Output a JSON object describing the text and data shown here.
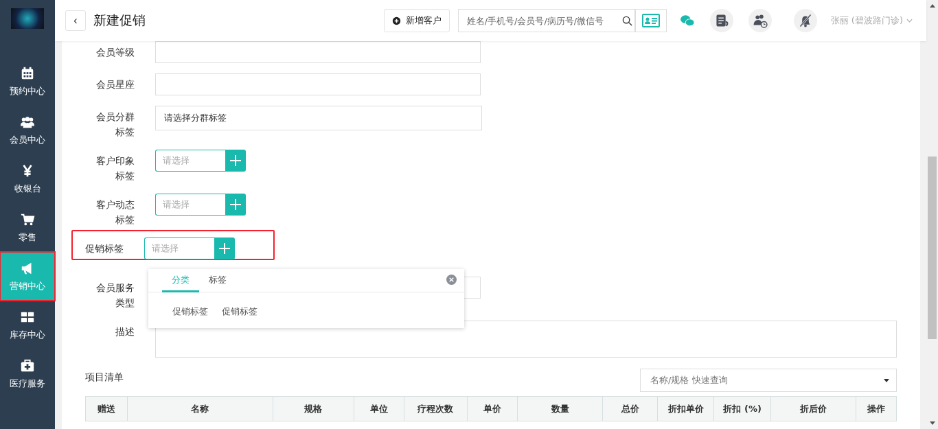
{
  "sidebar": {
    "items": [
      {
        "label": "预约中心",
        "selected": false,
        "highlighted": false
      },
      {
        "label": "会员中心",
        "selected": false,
        "highlighted": false
      },
      {
        "label": "收银台",
        "selected": false,
        "highlighted": false
      },
      {
        "label": "零售",
        "selected": false,
        "highlighted": false
      },
      {
        "label": "营销中心",
        "selected": true,
        "highlighted": true
      },
      {
        "label": "库存中心",
        "selected": false,
        "highlighted": false
      },
      {
        "label": "医疗服务",
        "selected": false,
        "highlighted": false
      }
    ]
  },
  "header": {
    "back": "‹",
    "title": "新建促销",
    "add_customer_button": "新增客户",
    "search": {
      "placeholder": "姓名/手机号/会员号/病历号/微信号"
    },
    "user": "张丽 (碧波路门诊)"
  },
  "form": {
    "rows": [
      {
        "kind": "text",
        "label": "会员等级",
        "highlighted": false
      },
      {
        "kind": "text",
        "label": "会员星座",
        "highlighted": false
      },
      {
        "kind": "text",
        "label": "会员分群标签",
        "value": "请选择分群标签",
        "highlighted": false
      },
      {
        "kind": "select-add",
        "label": "客户印象标签",
        "placeholder": "请选择",
        "highlighted": false
      },
      {
        "kind": "select-add",
        "label": "客户动态标签",
        "placeholder": "请选择",
        "highlighted": false
      },
      {
        "kind": "select-add",
        "label": "促销标签",
        "placeholder": "请选择",
        "highlighted": true,
        "popup": {
          "tabs": [
            {
              "label": "分类",
              "selected": true
            },
            {
              "label": "标签",
              "selected": false
            }
          ],
          "items": [
            "促销标签",
            "促销标签"
          ]
        }
      },
      {
        "kind": "text",
        "label": "会员服务类型",
        "highlighted": false
      },
      {
        "kind": "textarea",
        "label": "描述",
        "highlighted": false
      }
    ]
  },
  "items_section": {
    "title": "项目清单",
    "quick_search": {
      "placeholder": "名称/规格 快速查询"
    },
    "table": {
      "columns": [
        "赠送",
        "名称",
        "规格",
        "单位",
        "疗程次数",
        "单价",
        "数量",
        "总价",
        "折扣单价",
        "折扣 (%)",
        "折后价",
        "操作"
      ]
    }
  }
}
